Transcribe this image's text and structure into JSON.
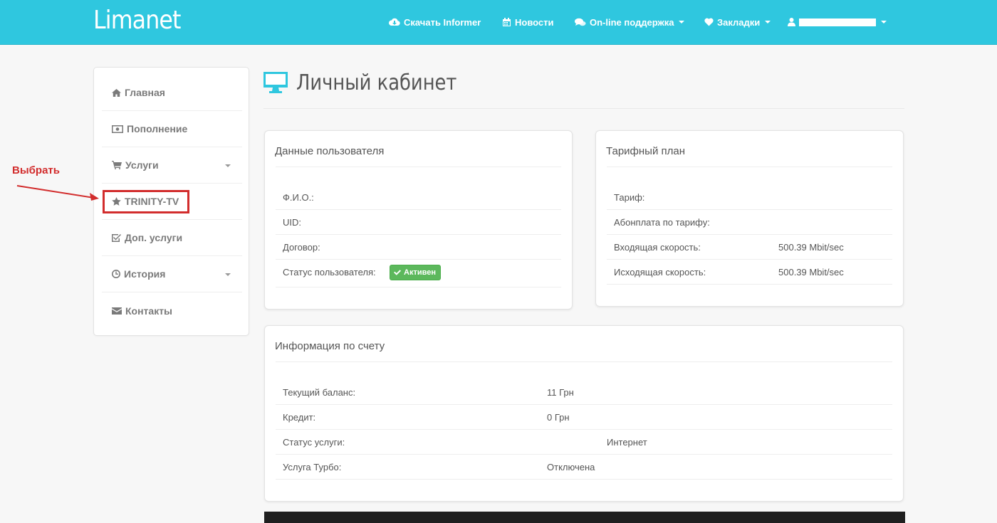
{
  "brand": "Limanet",
  "nav": {
    "download": "Скачать Informer",
    "news": "Новости",
    "support": "On-line поддержка",
    "bookmarks": "Закладки"
  },
  "sidebar": {
    "items": [
      {
        "label": "Главная",
        "icon": "home-icon"
      },
      {
        "label": "Пополнение",
        "icon": "money-icon"
      },
      {
        "label": "Услуги",
        "icon": "cart-icon"
      },
      {
        "label": "TRINITY-TV",
        "icon": "star-icon"
      },
      {
        "label": "Доп. услуги",
        "icon": "checkbox-icon"
      },
      {
        "label": "История",
        "icon": "clock-icon"
      },
      {
        "label": "Контакты",
        "icon": "envelope-icon"
      }
    ]
  },
  "annotation": {
    "label": "Выбрать",
    "color": "#d22d2d"
  },
  "page_title": "Личный кабинет",
  "user_panel": {
    "title": "Данные пользователя",
    "rows": [
      {
        "key": "Ф.И.О.:",
        "value": ""
      },
      {
        "key": "UID:",
        "value": ""
      },
      {
        "key": "Договор:",
        "value": ""
      },
      {
        "key": "Статус пользователя:",
        "value": ""
      }
    ],
    "status_badge": "Активен"
  },
  "tariff_panel": {
    "title": "Тарифный план",
    "rows": [
      {
        "key": "Тариф:",
        "value": ""
      },
      {
        "key": "Абонплата по тарифу:",
        "value": ""
      },
      {
        "key": "Входящая скорость:",
        "value": "500.39 Mbit/sec"
      },
      {
        "key": "Исходящая скорость:",
        "value": "500.39 Mbit/sec"
      }
    ]
  },
  "account_panel": {
    "title": "Информация по счету",
    "rows": [
      {
        "key": "Текущий баланс:",
        "value": "11 Грн"
      },
      {
        "key": "Кредит:",
        "value": "0 Грн"
      },
      {
        "key": "Статус услуги:",
        "value": "Интернет"
      },
      {
        "key": "Услуга Турбо:",
        "value": "Отключена"
      }
    ]
  },
  "colors": {
    "navbar": "#2fc7df",
    "accent": "#2fc7df",
    "success": "#5cb85c"
  }
}
